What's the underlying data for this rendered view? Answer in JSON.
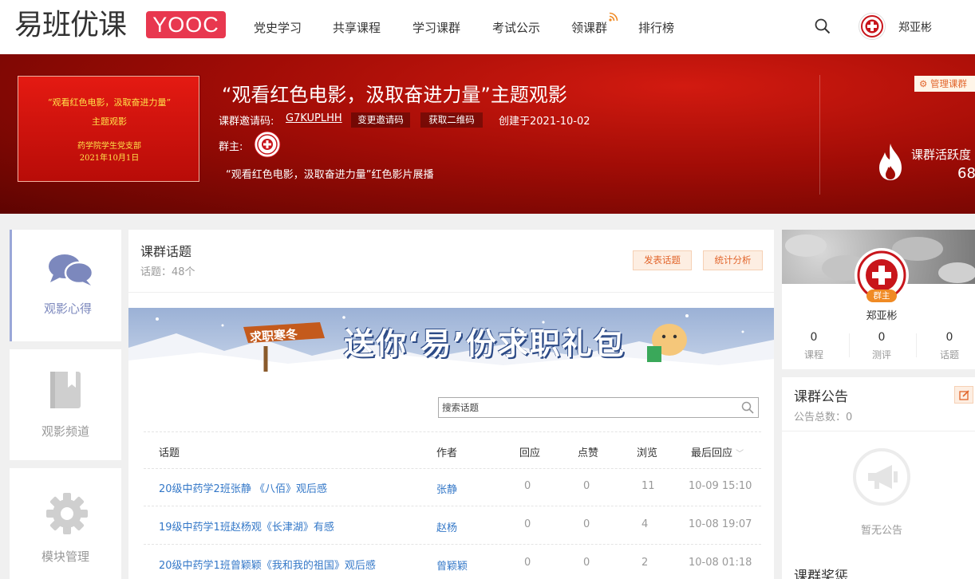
{
  "header": {
    "logo_cn": "易班优课",
    "logo_en": "YOOC",
    "nav": [
      "党史学习",
      "共享课程",
      "学习课群",
      "考试公示",
      "领课群",
      "排行榜"
    ],
    "username": "郑亚彬"
  },
  "banner": {
    "poster": {
      "line1": "“观看红色电影，汲取奋进力量”",
      "line2": "主题观影",
      "line3": "药学院学生党支部",
      "line4": "2021年10月1日"
    },
    "title": "“观看红色电影，汲取奋进力量”主题观影",
    "invite_label": "课群邀请码:",
    "invite_code": "G7KUPLHH",
    "change_code": "变更邀请码",
    "get_qr": "获取二维码",
    "created": "创建于2021-10-02",
    "owner_label": "群主:",
    "description": "“观看红色电影，汲取奋进力量”红色影片展播",
    "manage": "管理课群",
    "activity_label": "课群活跃度",
    "activity_value": "68"
  },
  "left_nav": [
    {
      "label": "观影心得",
      "icon": "chat-bubbles-icon"
    },
    {
      "label": "观影频道",
      "icon": "book-icon"
    },
    {
      "label": "模块管理",
      "icon": "gear-icon"
    }
  ],
  "main": {
    "title": "课群话题",
    "count": "话题：48个",
    "post_btn": "发表话题",
    "stats_btn": "统计分析",
    "ad": {
      "sign": "求职寒冬",
      "slogan": "送你‘易’份求职礼包"
    },
    "search_placeholder": "搜索话题",
    "columns": [
      "话题",
      "作者",
      "回应",
      "点赞",
      "浏览",
      "最后回应"
    ],
    "rows": [
      {
        "topic": "20级中药学2班张静 《八佰》观后感",
        "author": "张静",
        "replies": "0",
        "likes": "0",
        "views": "11",
        "last": "10-09 15:10"
      },
      {
        "topic": "19级中药学1班赵杨观《长津湖》有感",
        "author": "赵杨",
        "replies": "0",
        "likes": "0",
        "views": "4",
        "last": "10-08 19:07"
      },
      {
        "topic": "20级中药学1班曾颖颖《我和我的祖国》观后感",
        "author": "曾颖颖",
        "replies": "0",
        "likes": "0",
        "views": "2",
        "last": "10-08 01:18"
      }
    ]
  },
  "right": {
    "owner_badge": "群主",
    "owner_name": "郑亚彬",
    "stats": [
      {
        "num": "0",
        "label": "课程"
      },
      {
        "num": "0",
        "label": "测评"
      },
      {
        "num": "0",
        "label": "话题"
      }
    ],
    "notice_title": "课群公告",
    "notice_count": "公告总数：0",
    "no_notice": "暂无公告",
    "next_title": "课群奖惩"
  }
}
